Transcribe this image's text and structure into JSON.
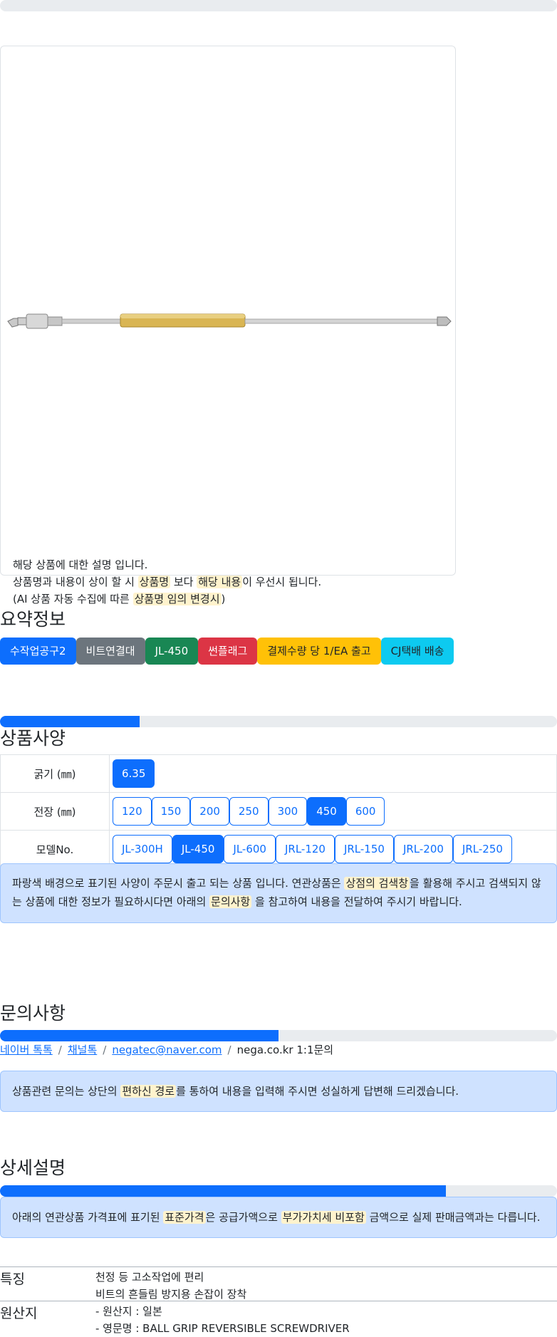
{
  "product_card": {
    "image_alt": "JL-450 bit extension bar",
    "desc_line1": "해당 상품에 대한 설명 입니다.",
    "desc_line2_a": "상품명과 내용이 상이 할 시",
    "desc_line2_mark1": "상품명",
    "desc_line2_b": "보다",
    "desc_line2_mark2": "해당 내용",
    "desc_line2_c": "이 우선시 됩니다.",
    "desc_line3_a": "(AI 상품 자동 수집에 따른",
    "desc_line3_mark": "상품명 임의 변경시",
    "desc_line3_b": ")"
  },
  "summary": {
    "title": "요약정보",
    "badges": [
      "수작업공구2",
      "비트연결대",
      "JL-450",
      "썬플래그",
      "결제수량 당 1/EA 출고",
      "CJ택배 배송"
    ],
    "badge_colors": [
      "#0d6efd",
      "#6c757d",
      "#198754",
      "#dc3545",
      "#ffc107",
      "#0dcaf0"
    ],
    "progress": 0.25
  },
  "specs": {
    "title": "상품사양",
    "rows": [
      {
        "label": "굵기 (㎜)",
        "options": [
          "6.35"
        ],
        "selected": "6.35"
      },
      {
        "label": "전장 (㎜)",
        "options": [
          "120",
          "150",
          "200",
          "250",
          "300",
          "450",
          "600"
        ],
        "selected": "450"
      },
      {
        "label": "모델No.",
        "options": [
          "JL-300H",
          "JL-450",
          "JL-600",
          "JRL-120",
          "JRL-150",
          "JRL-200",
          "JRL-250"
        ],
        "selected": "JL-450"
      }
    ],
    "notice_a": "파랑색 배경으로 표기된 사양이 주문시 출고 되는 상품 입니다. 연관상품은",
    "notice_mark1": "상점의 검색창",
    "notice_b": "을 활용해 주시고 검색되지 않는 상품에 대한 정보가 필요하시다면 아래의",
    "notice_mark2": "문의사항",
    "notice_c": "을 참고하여 내용을 전달하여 주시기 바랍니다."
  },
  "inquiry": {
    "title": "문의사항",
    "progress": 0.5,
    "link1": "네이버 톡톡",
    "link2": "채널톡",
    "link3": "negatec@naver.com",
    "text4": "nega.co.kr 1:1문의",
    "sep": "/",
    "notice_a": "상품관련 문의는 상단의",
    "notice_mark": "편하신 경로",
    "notice_b": "를 통하여 내용을 입력해 주시면 성실하게 답변해 드리겠습니다."
  },
  "details": {
    "title": "상세설명",
    "progress": 0.8,
    "notice_a": "아래의 연관상품 가격표에 표기된",
    "notice_mark1": "표준가격",
    "notice_b": "은 공급가액으로",
    "notice_mark2": "부가가치세 비포함",
    "notice_c": "금액으로 실제 판매금액과는 다릅니다.",
    "feature_label": "특징",
    "feature_lines": [
      "천정 등 고소작업에 편리",
      "비트의 흔들림 방지용 손잡이 장착"
    ],
    "origin_label": "원산지",
    "origin_lines": [
      "- 원산지 : 일본",
      "- 영문명 : BALL GRIP REVERSIBLE SCREWDRIVER"
    ]
  }
}
